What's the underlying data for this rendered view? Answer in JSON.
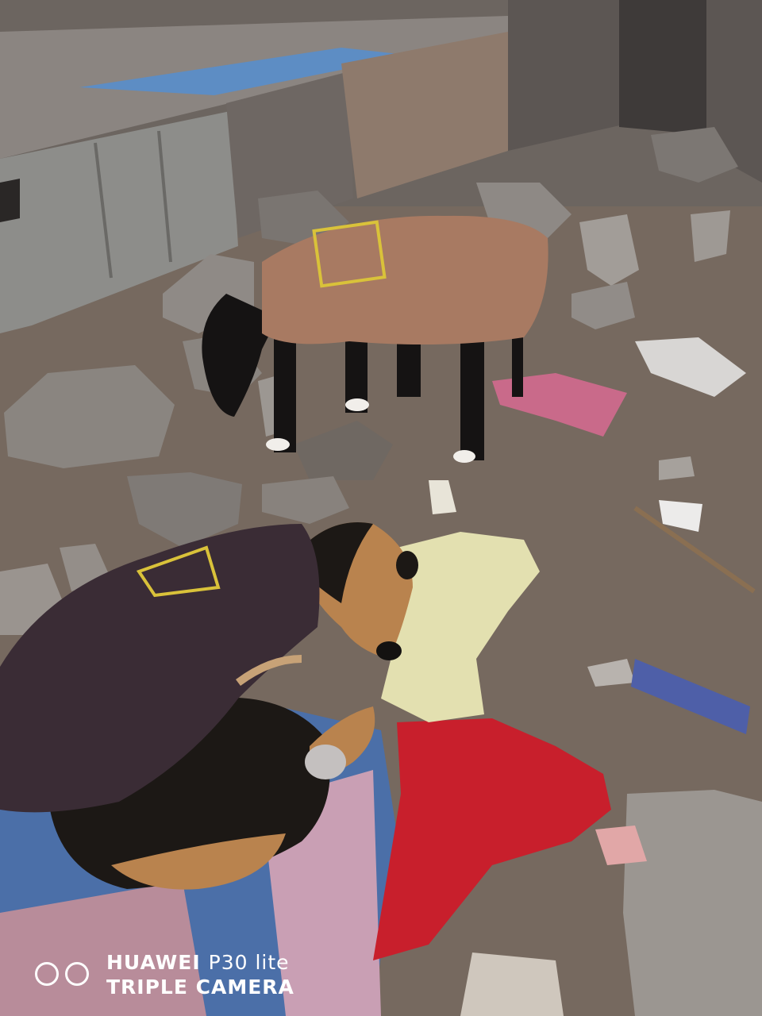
{
  "image": {
    "description_icons": [
      "dog-upright-icon",
      "dog-lying-icon"
    ],
    "palette": {
      "ground": "#7a6a5e",
      "rock": "#8e8882",
      "coat_tan": "#a87a62",
      "coat_purple": "#3a2c35",
      "dog_black": "#151313",
      "dog_brown": "#b9834e",
      "blanket_red": "#c81f2c",
      "blanket_blue": "#4b6fa8",
      "cloth_cream": "#e3e0b0"
    }
  },
  "watermark": {
    "brand": "HUAWEI",
    "model": "P30 lite",
    "camera": "TRIPLE CAMERA"
  }
}
